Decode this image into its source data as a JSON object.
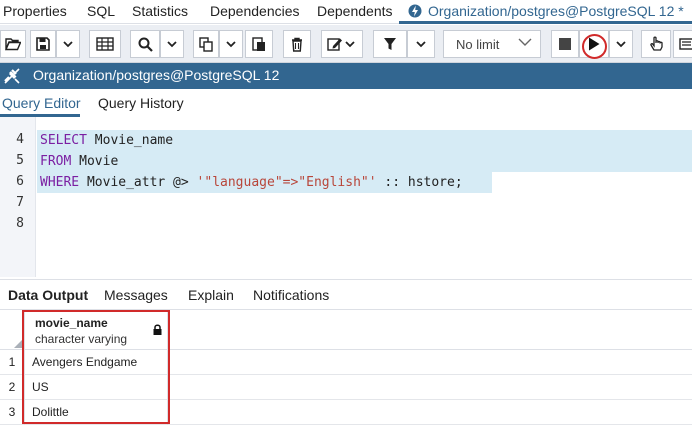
{
  "top_tabs": [
    "Properties",
    "SQL",
    "Statistics",
    "Dependencies",
    "Dependents"
  ],
  "active_tab": "Organization/postgres@PostgreSQL 12 *",
  "toolbar": {
    "limit_value": "No limit"
  },
  "connection": {
    "label": "Organization/postgres@PostgreSQL 12"
  },
  "editor_tabs": [
    "Query Editor",
    "Query History"
  ],
  "editor": {
    "lines": [
      {
        "num": "4",
        "keyword": "SELECT",
        "rest": " Movie_name"
      },
      {
        "num": "5",
        "keyword": "FROM",
        "rest": " Movie"
      },
      {
        "num": "6",
        "keyword": "WHERE",
        "rest": " Movie_attr @> ",
        "string": "'\"language\"=>\"English\"'",
        "tail": " :: hstore;"
      },
      {
        "num": "7"
      },
      {
        "num": "8"
      }
    ]
  },
  "result_tabs": [
    "Data Output",
    "Messages",
    "Explain",
    "Notifications"
  ],
  "grid": {
    "column": {
      "name": "movie_name",
      "type": "character varying"
    },
    "rows": [
      {
        "num": "1",
        "value": "Avengers Endgame"
      },
      {
        "num": "2",
        "value": "US"
      },
      {
        "num": "3",
        "value": "Dolittle"
      }
    ]
  },
  "colors": {
    "accent": "#326690",
    "highlight": "#d12a2a",
    "selection": "#d6ebf5"
  }
}
